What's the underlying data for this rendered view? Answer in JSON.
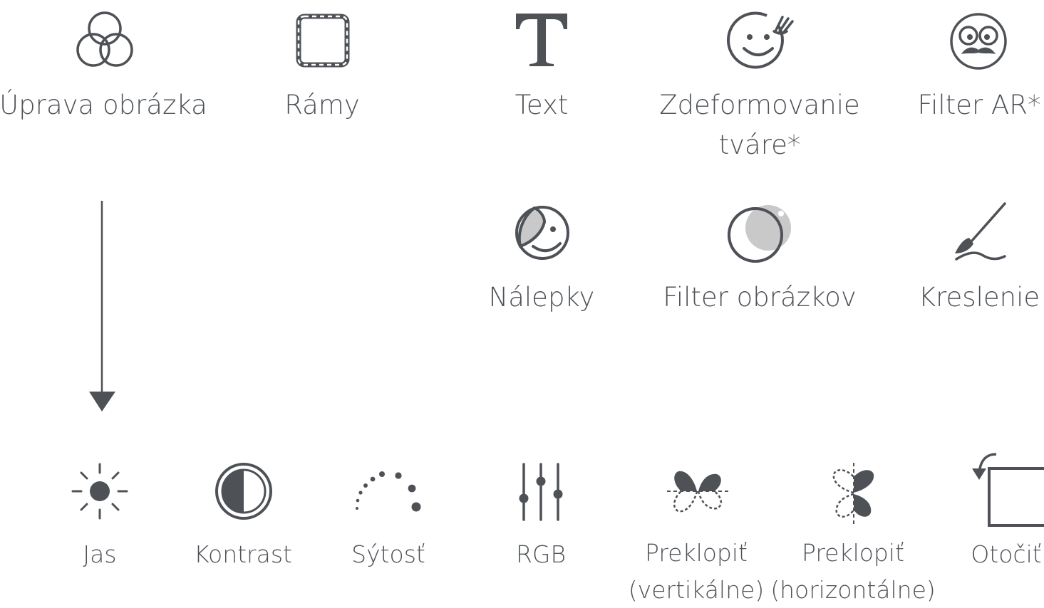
{
  "top_row": {
    "image_edit": "Úprava obrázka",
    "frames": "Rámy",
    "text": "Text",
    "face_warp_line1": "Zdeformovanie",
    "face_warp_line2": "tváre*",
    "ar_filter": "Filter AR*"
  },
  "middle_row": {
    "stickers": "Nálepky",
    "image_filter": "Filter obrázkov",
    "drawing": "Kreslenie"
  },
  "bottom_row": {
    "brightness": "Jas",
    "contrast": "Kontrast",
    "saturation": "Sýtosť",
    "rgb": "RGB",
    "flip_v_line1": "Preklopiť",
    "flip_v_line2": "(vertikálne)",
    "flip_h_line1": "Preklopiť",
    "flip_h_line2": "(horizontálne)",
    "rotate": "Otočiť"
  },
  "colors": {
    "icon": "#4e5257",
    "text": "#4e5257",
    "background": "#ffffff",
    "filter_fill": "#c9c9c9"
  }
}
